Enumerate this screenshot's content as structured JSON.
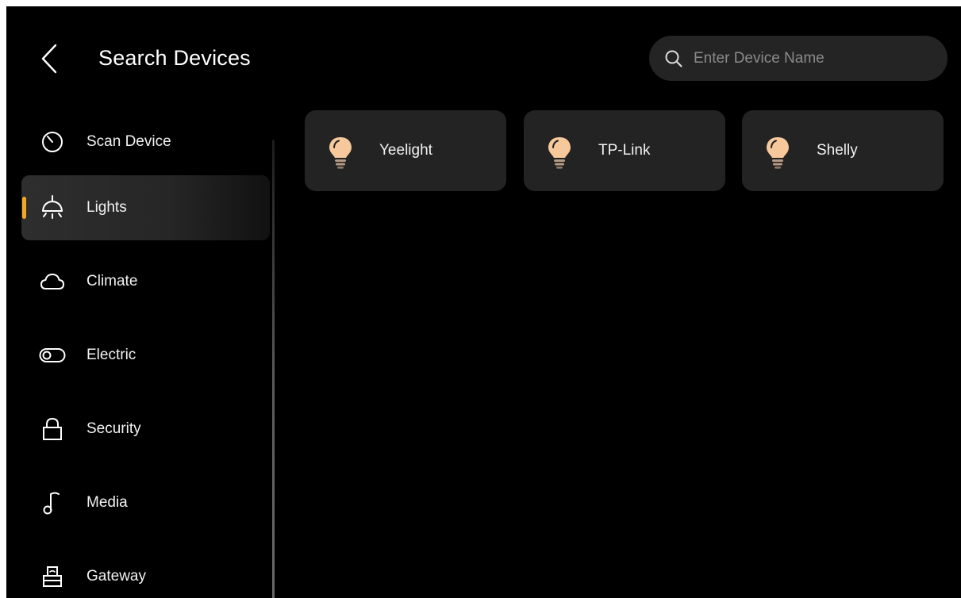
{
  "header": {
    "title": "Search Devices",
    "back_icon": "chevron-left-icon"
  },
  "search": {
    "placeholder": "Enter Device Name",
    "value": "",
    "icon": "search-icon"
  },
  "sidebar": {
    "active_index": 1,
    "accent_color": "#f5a623",
    "items": [
      {
        "label": "Scan Device",
        "icon": "scan-timer-icon"
      },
      {
        "label": "Lights",
        "icon": "ceiling-light-icon"
      },
      {
        "label": "Climate",
        "icon": "cloud-icon"
      },
      {
        "label": "Electric",
        "icon": "toggle-switch-icon"
      },
      {
        "label": "Security",
        "icon": "lock-icon"
      },
      {
        "label": "Media",
        "icon": "music-note-icon"
      },
      {
        "label": "Gateway",
        "icon": "router-icon"
      }
    ]
  },
  "devices": [
    {
      "name": "Yeelight",
      "icon": "light-bulb-icon"
    },
    {
      "name": "TP-Link",
      "icon": "light-bulb-icon"
    },
    {
      "name": "Shelly",
      "icon": "light-bulb-icon"
    }
  ],
  "colors": {
    "background": "#000000",
    "card": "#232323",
    "bulb": "#f7c89b",
    "accent": "#f5a623"
  }
}
